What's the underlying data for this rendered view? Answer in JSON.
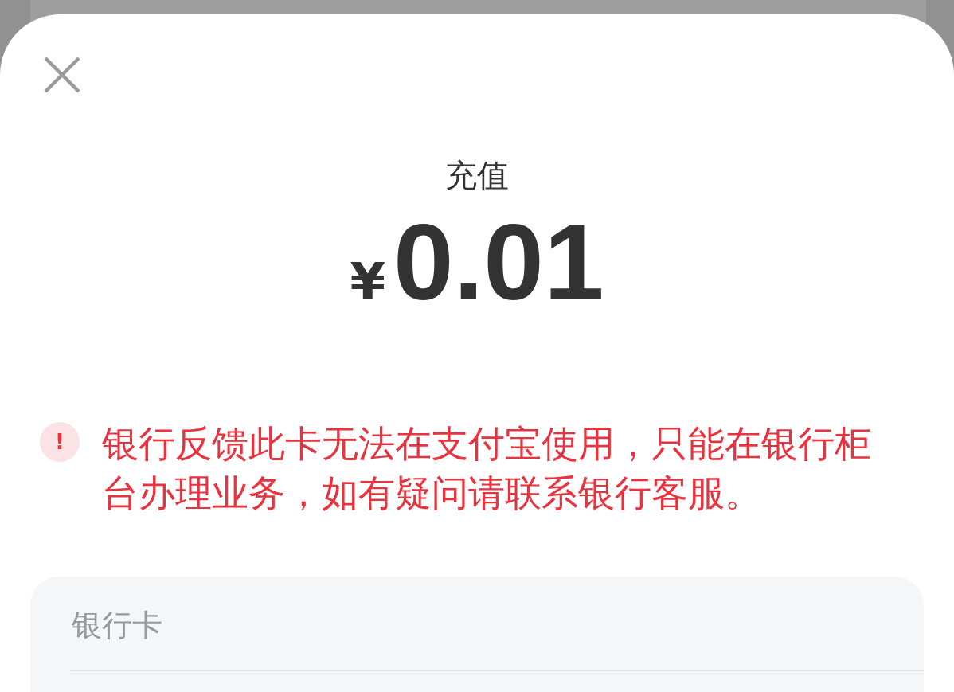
{
  "title": "充值",
  "amount": {
    "currency": "¥",
    "value": "0.01"
  },
  "warning": {
    "icon": "!",
    "message": "银行反馈此卡无法在支付宝使用，只能在银行柜台办理业务，如有疑问请联系银行客服。"
  },
  "payment_method": {
    "label": "银行卡"
  }
}
